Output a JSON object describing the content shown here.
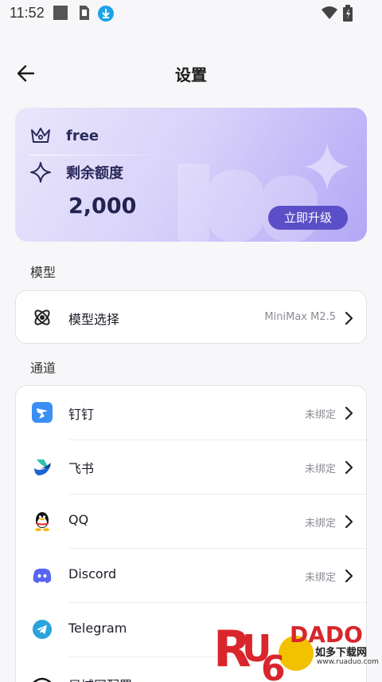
{
  "status_bar": {
    "time": "11:52"
  },
  "header": {
    "title": "设置"
  },
  "plan": {
    "name": "free",
    "quota_label": "剩余额度",
    "quota_value": "2,000",
    "upgrade_label": "立即升级"
  },
  "model_section": {
    "title": "模型",
    "items": [
      {
        "label": "模型选择",
        "value": "MiniMax M2.5",
        "icon": "model-atom-icon"
      }
    ]
  },
  "channel_section": {
    "title": "通道",
    "items": [
      {
        "label": "钉钉",
        "value": "未绑定",
        "icon": "dingtalk-icon"
      },
      {
        "label": "飞书",
        "value": "未绑定",
        "icon": "feishu-icon"
      },
      {
        "label": "QQ",
        "value": "未绑定",
        "icon": "qq-icon"
      },
      {
        "label": "Discord",
        "value": "未绑定",
        "icon": "discord-icon"
      },
      {
        "label": "Telegram",
        "value": "",
        "icon": "telegram-icon"
      },
      {
        "label": "局域网配置",
        "value": "",
        "icon": "wifi-icon"
      }
    ]
  },
  "watermark": {
    "brand": "RUANDADO",
    "subtitle": "如多下载网",
    "url": "www.ruaduo.com"
  },
  "colors": {
    "accent": "#5b4fc7",
    "card_bg": "#ffffff",
    "page_bg": "#f7f7f9"
  }
}
